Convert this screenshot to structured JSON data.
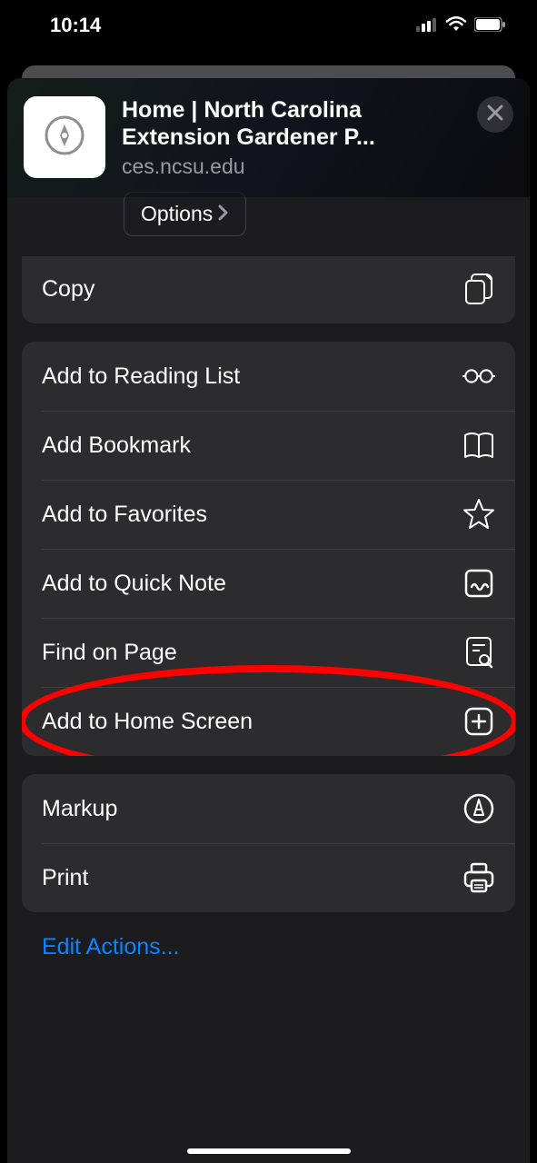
{
  "status": {
    "time": "10:14"
  },
  "header": {
    "title": "Home | North Carolina Extension Gardener P...",
    "url": "ces.ncsu.edu",
    "options_label": "Options"
  },
  "group1": {
    "copy": "Copy"
  },
  "group2": {
    "reading_list": "Add to Reading List",
    "bookmark": "Add Bookmark",
    "favorites": "Add to Favorites",
    "quick_note": "Add to Quick Note",
    "find": "Find on Page",
    "home_screen": "Add to Home Screen"
  },
  "group3": {
    "markup": "Markup",
    "print": "Print"
  },
  "footer": {
    "edit_actions": "Edit Actions..."
  }
}
